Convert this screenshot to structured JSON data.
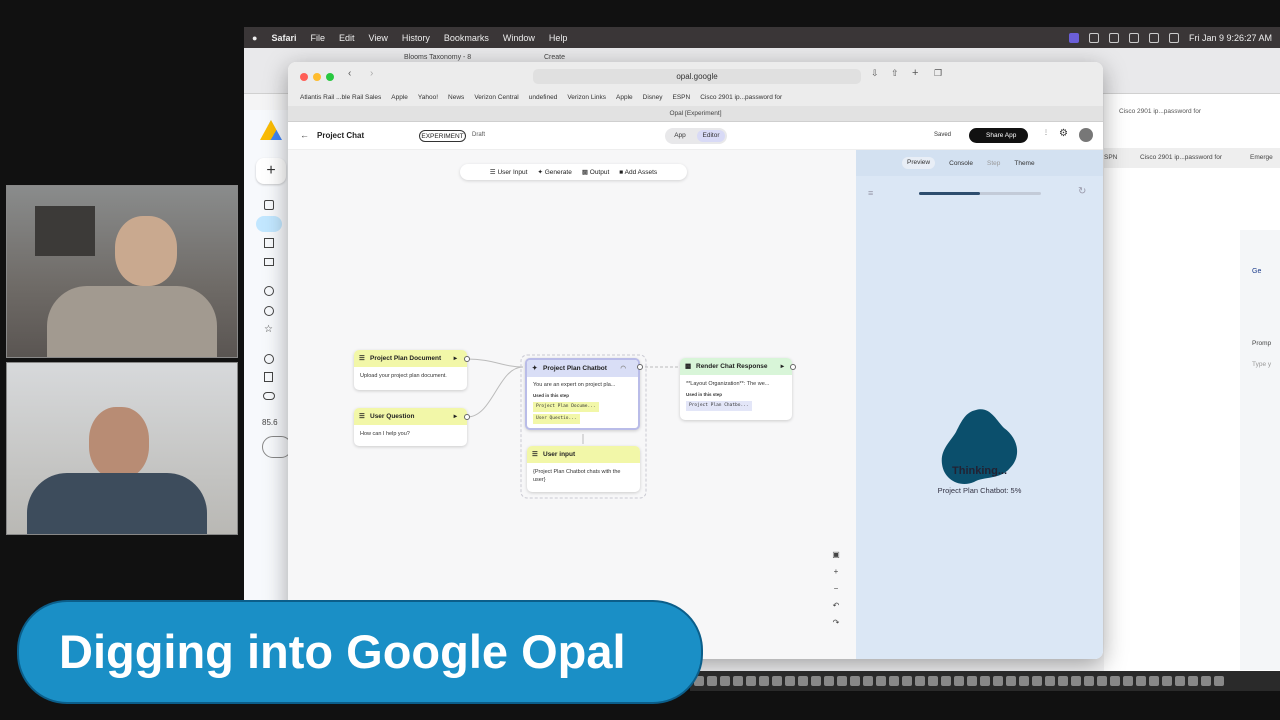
{
  "menubar": {
    "apple": "",
    "app": "Safari",
    "items": [
      "File",
      "Edit",
      "View",
      "History",
      "Bookmarks",
      "Window",
      "Help"
    ],
    "clock": "Fri Jan 9  9:26:27 AM"
  },
  "back_tabs": [
    "Blooms Taxonomy - 8",
    "Create"
  ],
  "back_right": {
    "bm1": "SPN",
    "bm2": "Cisco 2901 ip...password for",
    "bm3": "Emerge",
    "top": "Cisco 2901 ip...password for",
    "promp": "Promp",
    "type": "Type y",
    "ge": "Ge"
  },
  "drive": {
    "pct": "85.6"
  },
  "browser": {
    "url": "opal.google",
    "tab": "Opal [Experiment]",
    "bookmarks": [
      "Atlantis Rail ...ble Rail Sales",
      "Apple",
      "Yahoo!",
      "News",
      "Verizon Central",
      "undefined",
      "Verizon Links",
      "Apple",
      "Disney",
      "ESPN",
      "Cisco 2901 ip...password for"
    ]
  },
  "app": {
    "title": "Project Chat",
    "badge": "EXPERIMENT",
    "status": "Draft",
    "mode_app": "App",
    "mode_editor": "Editor",
    "saved": "Saved",
    "share": "Share App"
  },
  "toolbar": {
    "user_input": "User Input",
    "generate": "Generate",
    "output": "Output",
    "add_assets": "Add Assets"
  },
  "nodes": {
    "doc": {
      "title": "Project Plan Document",
      "body": "Upload your project plan document."
    },
    "q": {
      "title": "User Question",
      "body": "How can I help you?"
    },
    "bot": {
      "title": "Project Plan Chatbot",
      "body": "You are an expert on project pla...",
      "used": "Used in this step",
      "chip1": "Project Plan Docume...",
      "chip2": "User Questio..."
    },
    "render": {
      "title": "Render Chat Response",
      "body": "**Layout Organization**: The we...",
      "used": "Used in this step",
      "chip1": "Project Plan Chatbo..."
    },
    "input": {
      "title": "User input",
      "body": "{Project Plan Chatbot chats with the user}"
    }
  },
  "preview": {
    "tabs": [
      "Preview",
      "Console",
      "Step",
      "Theme"
    ],
    "progress": 0.5,
    "thinking": "Thinking...",
    "status": "Project Plan Chatbot: 5%"
  },
  "lower_third": "Digging into Google Opal",
  "colors": {
    "accent": "#1a8fc6",
    "blob": "#0b4f6c"
  }
}
